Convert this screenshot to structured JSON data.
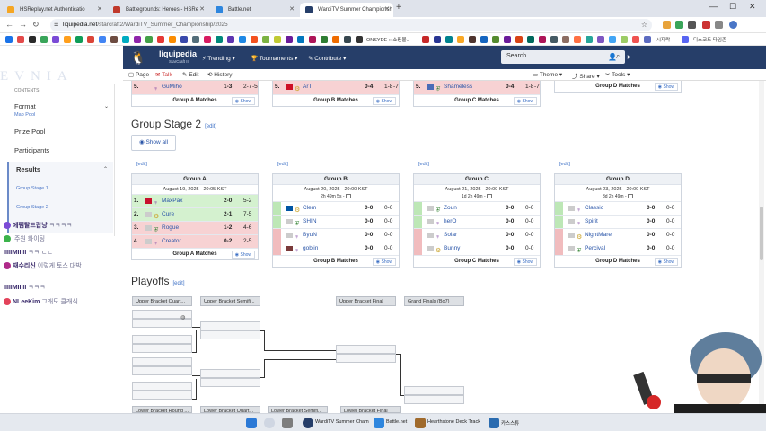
{
  "browser": {
    "tabs": [
      {
        "title": "HSReplay.net Authenticatio",
        "color": "#f5a623"
      },
      {
        "title": "Battlegrounds: Heroes - HSRe",
        "color": "#c0392b"
      },
      {
        "title": "Battle.net",
        "color": "#2e86de"
      },
      {
        "title": "WardiTV Summer Championsh",
        "color": "#263e69"
      }
    ],
    "url_domain": "liquipedia.net",
    "url_path": "/starcraft2/WardiTV_Summer_Championship/2025",
    "bookmarks": [
      {
        "label": "ONSYDE :: 쇼핑몰..",
        "color": "#333"
      },
      {
        "label": "시자락",
        "color": "#5577aa"
      },
      {
        "label": "디스코드 타임존",
        "color": "#5865f2"
      }
    ]
  },
  "header": {
    "brand": "liquipedia",
    "brand_sub": "StarCraft II",
    "menus": [
      "Trending",
      "Tournaments",
      "Contribute"
    ],
    "search_placeholder": "Search"
  },
  "subnav": {
    "left": [
      "Page",
      "Talk",
      "Edit",
      "History"
    ],
    "right": [
      "Theme",
      "Share",
      "Tools"
    ]
  },
  "sidebar": {
    "watermark": "EVNIA",
    "contents_label": "CONTENTS",
    "items": [
      {
        "label": "Format",
        "sub": "Map Pool"
      },
      {
        "label": "Prize Pool"
      },
      {
        "label": "Participants"
      },
      {
        "label": "Results",
        "subs": [
          "Group Stage 1",
          "Group Stage 2"
        ]
      }
    ]
  },
  "chat": [
    {
      "user": "에펨탈드랍냥",
      "msg": "ㅋㅋㅋㅋ",
      "color": "#7b4bd6"
    },
    {
      "user": "",
      "msg": "주원 화이팅",
      "color": "#3bb34a"
    },
    {
      "user": "IIIIIMIIIII",
      "msg": "ㅋㅋ ㄷㄷ",
      "color": "#333"
    },
    {
      "user": "재수리신",
      "msg": "이렇게 토스 대박",
      "color": "#b02a8a"
    },
    {
      "user": "IIIIIMIIIII",
      "msg": "ㅋㅋㅋ",
      "color": "#333"
    },
    {
      "user": "NLeeKim",
      "msg": "그래도 클래식",
      "color": "#e3425a"
    }
  ],
  "top_rows": [
    {
      "rank": "5.",
      "name": "GuMiho",
      "s1": "1-3",
      "s2": "2-7",
      "s3": "-5",
      "footer": "Group A Matches"
    },
    {
      "rank": "5.",
      "name": "ArT",
      "s1": "0-4",
      "s2": "1-8",
      "s3": "-7",
      "footer": "Group B Matches"
    },
    {
      "rank": "5.",
      "name": "Shameless",
      "s1": "0-4",
      "s2": "1-8",
      "s3": "-7",
      "footer": "Group C Matches"
    },
    {
      "rank": "",
      "name": "",
      "s1": "",
      "s2": "",
      "s3": "",
      "footer": "Group D Matches"
    }
  ],
  "show_label": "Show",
  "edit_label": "edit",
  "group_stage2": {
    "title": "Group Stage 2",
    "show_all": "Show all",
    "groups": [
      {
        "name": "Group A",
        "date": "August 19, 2025 - 20:05 KST",
        "countdown": "",
        "footer": "Group A Matches",
        "rows": [
          {
            "rank": "1.",
            "name": "MaxPax",
            "s1": "2-0",
            "s2": "5-2",
            "state": "up",
            "flag": "#c8102e"
          },
          {
            "rank": "2.",
            "name": "Cure",
            "s1": "2-1",
            "s2": "7-5",
            "state": "up",
            "flag": "#cccccc"
          },
          {
            "rank": "3.",
            "name": "Rogue",
            "s1": "1-2",
            "s2": "4-6",
            "state": "down",
            "flag": "#cccccc"
          },
          {
            "rank": "4.",
            "name": "Creator",
            "s1": "0-2",
            "s2": "2-5",
            "state": "down",
            "flag": "#cccccc"
          }
        ]
      },
      {
        "name": "Group B",
        "date": "August 20, 2025 - 20:00 KST",
        "countdown": "2h 49m 5s -",
        "footer": "Group B Matches",
        "rows": [
          {
            "rank": "",
            "name": "Clem",
            "s1": "0-0",
            "s2": "0-0",
            "state": "up",
            "flag": "#0055a4"
          },
          {
            "rank": "",
            "name": "SHIN",
            "s1": "0-0",
            "s2": "0-0",
            "state": "up",
            "flag": "#cccccc"
          },
          {
            "rank": "",
            "name": "ByuN",
            "s1": "0-0",
            "s2": "0-0",
            "state": "down",
            "flag": "#cccccc"
          },
          {
            "rank": "",
            "name": "goblin",
            "s1": "0-0",
            "s2": "0-0",
            "state": "down",
            "flag": "#7a3a3a"
          }
        ]
      },
      {
        "name": "Group C",
        "date": "August 21, 2025 - 20:00 KST",
        "countdown": "1d 2h 49m -",
        "footer": "Group C Matches",
        "rows": [
          {
            "rank": "",
            "name": "Zoun",
            "s1": "0-0",
            "s2": "0-0",
            "state": "up",
            "flag": "#cccccc"
          },
          {
            "rank": "",
            "name": "herO",
            "s1": "0-0",
            "s2": "0-0",
            "state": "up",
            "flag": "#cccccc"
          },
          {
            "rank": "",
            "name": "Solar",
            "s1": "0-0",
            "s2": "0-0",
            "state": "down",
            "flag": "#cccccc"
          },
          {
            "rank": "",
            "name": "Bunny",
            "s1": "0-0",
            "s2": "0-0",
            "state": "down",
            "flag": "#cccccc"
          }
        ]
      },
      {
        "name": "Group D",
        "date": "August 23, 2025 - 20:00 KST",
        "countdown": "3d 2h 49m -",
        "footer": "Group D Matches",
        "rows": [
          {
            "rank": "",
            "name": "Classic",
            "s1": "0-0",
            "s2": "0-0",
            "state": "up",
            "flag": "#cccccc"
          },
          {
            "rank": "",
            "name": "Spirit",
            "s1": "0-0",
            "s2": "0-0",
            "state": "up",
            "flag": "#cccccc"
          },
          {
            "rank": "",
            "name": "NightMare",
            "s1": "0-0",
            "s2": "0-0",
            "state": "down",
            "flag": "#cccccc"
          },
          {
            "rank": "",
            "name": "Percival",
            "s1": "0-0",
            "s2": "0-0",
            "state": "down",
            "flag": "#cccccc"
          }
        ]
      }
    ]
  },
  "playoffs": {
    "title": "Playoffs",
    "headers": [
      "Upper Bracket Quart...",
      "Upper Bracket Semifi...",
      "Upper Bracket Final",
      "Grand Finals (Bo7)"
    ],
    "lower_headers": [
      "Lower Bracket Round ...",
      "Lower Bracket Quart...",
      "Lower Bracket Semifi...",
      "Lower Bracket Final"
    ]
  },
  "taskbar": {
    "items": [
      {
        "label": "WardiTV Summer Cham",
        "color": "#263e69"
      },
      {
        "label": "Battle.net",
        "color": "#2e86de"
      },
      {
        "label": "Hearthstone Deck Track",
        "color": "#a06a2c"
      },
      {
        "label": "카스스튜",
        "color": "#2b6cb0"
      }
    ]
  },
  "colors": {
    "header_bg": "#263e69",
    "win": "#d4f1cf",
    "loss": "#f7d2d3",
    "link": "#2a55a8"
  }
}
